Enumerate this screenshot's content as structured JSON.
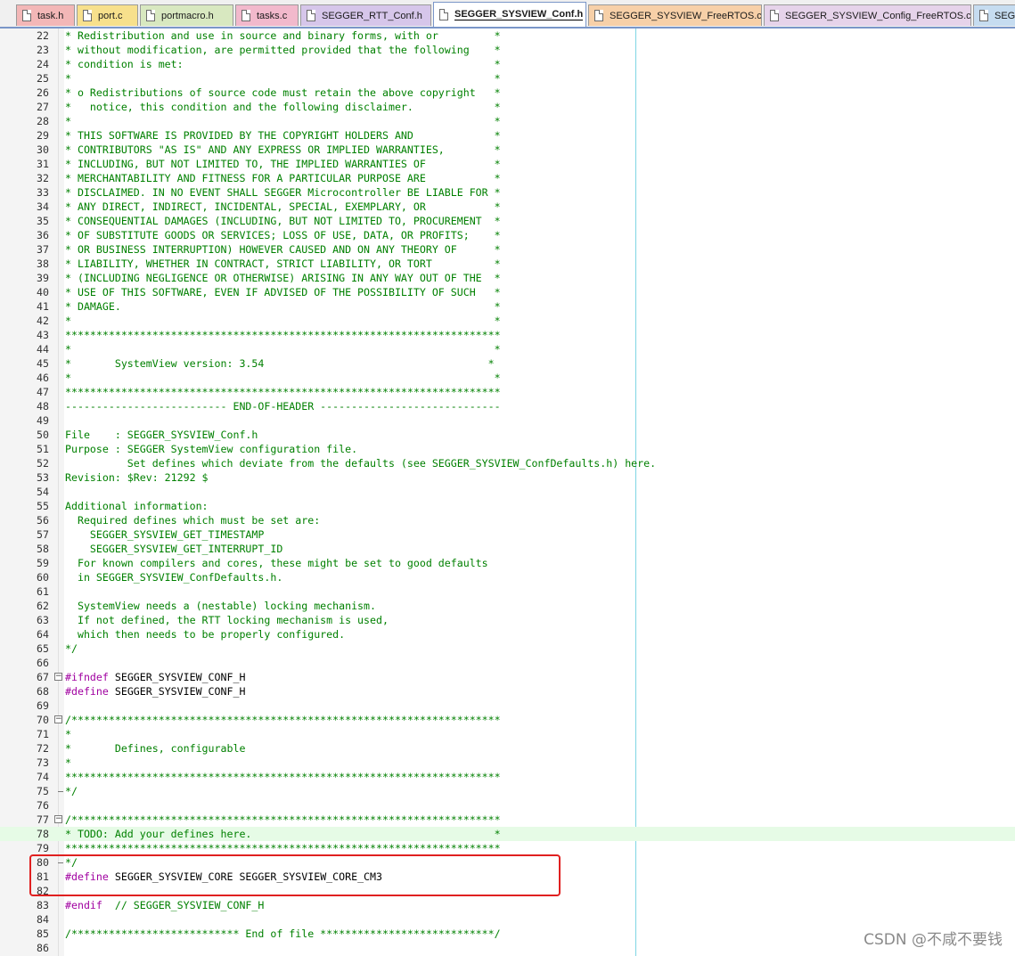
{
  "tabs": [
    {
      "label": "task.h",
      "color": "#f3b7b7"
    },
    {
      "label": "port.c",
      "color": "#f7e08c"
    },
    {
      "label": "portmacro.h",
      "color": "#d8e8c0"
    },
    {
      "label": "tasks.c",
      "color": "#f2b9cc"
    },
    {
      "label": "SEGGER_RTT_Conf.h",
      "color": "#d6c6ea"
    },
    {
      "label": "SEGGER_SYSVIEW_Conf.h",
      "color": "#ffffff",
      "active": true
    },
    {
      "label": "SEGGER_SYSVIEW_FreeRTOS.c",
      "color": "#f7d0a8"
    },
    {
      "label": "SEGGER_SYSVIEW_Config_FreeRTOS.c",
      "color": "#e6d3ea"
    },
    {
      "label": "SEG",
      "color": "#c6dcf0"
    }
  ],
  "lines": [
    {
      "n": "22",
      "t": "* Redistribution and use in source and binary forms, with or         *"
    },
    {
      "n": "23",
      "t": "* without modification, are permitted provided that the following    *"
    },
    {
      "n": "24",
      "t": "* condition is met:                                                  *"
    },
    {
      "n": "25",
      "t": "*                                                                    *"
    },
    {
      "n": "26",
      "t": "* o Redistributions of source code must retain the above copyright   *"
    },
    {
      "n": "27",
      "t": "*   notice, this condition and the following disclaimer.             *"
    },
    {
      "n": "28",
      "t": "*                                                                    *"
    },
    {
      "n": "29",
      "t": "* THIS SOFTWARE IS PROVIDED BY THE COPYRIGHT HOLDERS AND             *"
    },
    {
      "n": "30",
      "t": "* CONTRIBUTORS \"AS IS\" AND ANY EXPRESS OR IMPLIED WARRANTIES,        *"
    },
    {
      "n": "31",
      "t": "* INCLUDING, BUT NOT LIMITED TO, THE IMPLIED WARRANTIES OF           *"
    },
    {
      "n": "32",
      "t": "* MERCHANTABILITY AND FITNESS FOR A PARTICULAR PURPOSE ARE           *"
    },
    {
      "n": "33",
      "t": "* DISCLAIMED. IN NO EVENT SHALL SEGGER Microcontroller BE LIABLE FOR *"
    },
    {
      "n": "34",
      "t": "* ANY DIRECT, INDIRECT, INCIDENTAL, SPECIAL, EXEMPLARY, OR           *"
    },
    {
      "n": "35",
      "t": "* CONSEQUENTIAL DAMAGES (INCLUDING, BUT NOT LIMITED TO, PROCUREMENT  *"
    },
    {
      "n": "36",
      "t": "* OF SUBSTITUTE GOODS OR SERVICES; LOSS OF USE, DATA, OR PROFITS;    *"
    },
    {
      "n": "37",
      "t": "* OR BUSINESS INTERRUPTION) HOWEVER CAUSED AND ON ANY THEORY OF      *"
    },
    {
      "n": "38",
      "t": "* LIABILITY, WHETHER IN CONTRACT, STRICT LIABILITY, OR TORT          *"
    },
    {
      "n": "39",
      "t": "* (INCLUDING NEGLIGENCE OR OTHERWISE) ARISING IN ANY WAY OUT OF THE  *"
    },
    {
      "n": "40",
      "t": "* USE OF THIS SOFTWARE, EVEN IF ADVISED OF THE POSSIBILITY OF SUCH   *"
    },
    {
      "n": "41",
      "t": "* DAMAGE.                                                            *"
    },
    {
      "n": "42",
      "t": "*                                                                    *"
    },
    {
      "n": "43",
      "t": "**********************************************************************"
    },
    {
      "n": "44",
      "t": "*                                                                    *"
    },
    {
      "n": "45",
      "t": "*       SystemView version: 3.54                                    *"
    },
    {
      "n": "46",
      "t": "*                                                                    *"
    },
    {
      "n": "47",
      "t": "**********************************************************************"
    },
    {
      "n": "48",
      "t": "-------------------------- END-OF-HEADER -----------------------------"
    },
    {
      "n": "49",
      "t": ""
    },
    {
      "n": "50",
      "t": "File    : SEGGER_SYSVIEW_Conf.h"
    },
    {
      "n": "51",
      "t": "Purpose : SEGGER SystemView configuration file."
    },
    {
      "n": "52",
      "t": "          Set defines which deviate from the defaults (see SEGGER_SYSVIEW_ConfDefaults.h) here."
    },
    {
      "n": "53",
      "t": "Revision: $Rev: 21292 $"
    },
    {
      "n": "54",
      "t": ""
    },
    {
      "n": "55",
      "t": "Additional information:"
    },
    {
      "n": "56",
      "t": "  Required defines which must be set are:"
    },
    {
      "n": "57",
      "t": "    SEGGER_SYSVIEW_GET_TIMESTAMP"
    },
    {
      "n": "58",
      "t": "    SEGGER_SYSVIEW_GET_INTERRUPT_ID"
    },
    {
      "n": "59",
      "t": "  For known compilers and cores, these might be set to good defaults"
    },
    {
      "n": "60",
      "t": "  in SEGGER_SYSVIEW_ConfDefaults.h."
    },
    {
      "n": "61",
      "t": ""
    },
    {
      "n": "62",
      "t": "  SystemView needs a (nestable) locking mechanism."
    },
    {
      "n": "63",
      "t": "  If not defined, the RTT locking mechanism is used,"
    },
    {
      "n": "64",
      "t": "  which then needs to be properly configured."
    },
    {
      "n": "65",
      "t": "*/"
    },
    {
      "n": "66",
      "t": ""
    },
    {
      "n": "67",
      "pp": "#ifndef",
      "rest": " SEGGER_SYSVIEW_CONF_H",
      "fold": "start"
    },
    {
      "n": "68",
      "pp": "#define",
      "rest": " SEGGER_SYSVIEW_CONF_H"
    },
    {
      "n": "69",
      "t": ""
    },
    {
      "n": "70",
      "t": "/*********************************************************************",
      "fold": "start"
    },
    {
      "n": "71",
      "t": "*"
    },
    {
      "n": "72",
      "t": "*       Defines, configurable"
    },
    {
      "n": "73",
      "t": "*"
    },
    {
      "n": "74",
      "t": "**********************************************************************"
    },
    {
      "n": "75",
      "t": "*/",
      "fold": "end"
    },
    {
      "n": "76",
      "t": ""
    },
    {
      "n": "77",
      "t": "/*********************************************************************",
      "fold": "start"
    },
    {
      "n": "78",
      "t": "* TODO: Add your defines here.                                       *",
      "hl": true
    },
    {
      "n": "79",
      "t": "**********************************************************************"
    },
    {
      "n": "80",
      "t": "*/",
      "fold": "end"
    },
    {
      "n": "81",
      "pp": "#define",
      "rest": " SEGGER_SYSVIEW_CORE SEGGER_SYSVIEW_CORE_CM3"
    },
    {
      "n": "82",
      "t": ""
    },
    {
      "n": "83",
      "pp": "#endif",
      "t2": "  // SEGGER_SYSVIEW_CONF_H"
    },
    {
      "n": "84",
      "t": ""
    },
    {
      "n": "85",
      "t": "/*************************** End of file ****************************/"
    },
    {
      "n": "86",
      "t": ""
    }
  ],
  "watermark": "CSDN @不咸不要钱",
  "colors": {
    "comment": "#008000",
    "preprocessor": "#a000a0",
    "highlight_box": "#e02020",
    "edge_line": "#7fd6e4"
  }
}
